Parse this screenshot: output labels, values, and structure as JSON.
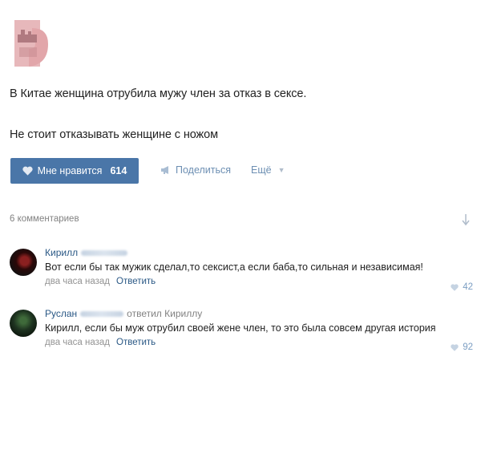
{
  "post": {
    "line1": "В Китае женщина отрубила мужу член за отказ в сексе.",
    "line2": "Не стоит отказывать женщине с ножом"
  },
  "actions": {
    "like_label": "Мне нравится",
    "like_count": "614",
    "share_label": "Поделиться",
    "more_label": "Ещё"
  },
  "comments_header": "6 комментариев",
  "comments": [
    {
      "author": "Кирилл",
      "text": "Вот если бы так мужик сделал,то сексист,а если баба,то сильная и независимая!",
      "time": "два часа назад",
      "reply": "Ответить",
      "likes": "42"
    },
    {
      "author": "Руслан",
      "reply_to": "ответил Кириллу",
      "text": "Кирилл, если бы муж отрубил своей жене член, то это была совсем другая история",
      "time": "два часа назад",
      "reply": "Ответить",
      "likes": "92"
    }
  ],
  "colors": {
    "accent": "#4a76a8",
    "link": "#2a5885",
    "muted": "#828282"
  }
}
